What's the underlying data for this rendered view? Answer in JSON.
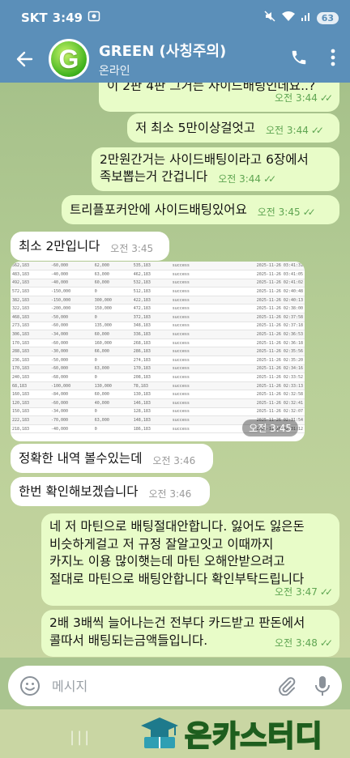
{
  "status": {
    "carrier": "SKT",
    "time": "3:49",
    "battery": "63"
  },
  "header": {
    "avatar_letter": "G",
    "title": "GREEN (사칭주의)",
    "subtitle": "온라인"
  },
  "messages": [
    {
      "text": "이 2판 4판 그거는 사이드배팅인데요..?",
      "time": "오전 3:44"
    },
    {
      "text": "저 최소 5만이상걸엇고",
      "time": "오전 3:44"
    },
    {
      "line1": "2만원간거는 사이드배팅이라고 6장에서",
      "line2": "족보뽑는거 간겁니다",
      "time": "오전 3:44"
    },
    {
      "text": "트리플포커안에 사이드배팅있어요",
      "time": "오전 3:45"
    },
    {
      "text": "최소 2만입니다",
      "time": "오전 3:45"
    },
    {
      "photo_time": "오전 3:45"
    },
    {
      "text": "정확한 내역 볼수있는데",
      "time": "오전 3:46"
    },
    {
      "text": "한번 확인해보겠습니다",
      "time": "오전 3:46"
    },
    {
      "lines": [
        "네 저 마틴으로 배팅절대안합니다. 잃어도 잃은돈",
        "비슷하게걸고 저 규정 잘알고잇고 이때까지",
        "카지노 이용 많이햇는데 마틴 오해안받으려고",
        "절대로 마틴으로 배팅안합니다 확인부탁드립니다"
      ],
      "time": "오전 3:47"
    },
    {
      "lines": [
        "2배 3배씩 늘어나는건 전부다 카드받고 판돈에서",
        "콜따서 배팅되는금액들입니다."
      ],
      "time": "오전 3:48"
    }
  ],
  "photo_table": [
    [
      "562,183",
      "-60,000",
      "62,000",
      "535,183",
      "success",
      "2025-11-26 03:41:31"
    ],
    [
      "483,183",
      "-40,000",
      "63,000",
      "462,183",
      "success",
      "2025-11-26 03:41:05"
    ],
    [
      "492,183",
      "-40,000",
      "60,000",
      "532,183",
      "success",
      "2025-11-26 02:41:02"
    ],
    [
      "572,183",
      "-150,000",
      "0",
      "512,183",
      "success",
      "2025-11-26 02:40:48"
    ],
    [
      "382,183",
      "-150,000",
      "300,000",
      "422,183",
      "success",
      "2025-11-26 02:40:13"
    ],
    [
      "322,183",
      "-200,000",
      "150,000",
      "472,183",
      "success",
      "2025-11-26 02:38:00"
    ],
    [
      "468,183",
      "-50,000",
      "0",
      "372,183",
      "success",
      "2025-11-26 02:37:58"
    ],
    [
      "273,183",
      "-60,000",
      "135,000",
      "348,183",
      "success",
      "2025-11-26 02:37:18"
    ],
    [
      "306,183",
      "-34,000",
      "60,000",
      "336,183",
      "success",
      "2025-11-26 02:36:53"
    ],
    [
      "170,183",
      "-60,000",
      "160,000",
      "268,183",
      "success",
      "2025-11-26 02:36:18"
    ],
    [
      "288,183",
      "-30,000",
      "66,000",
      "286,183",
      "success",
      "2025-11-26 02:35:56"
    ],
    [
      "236,183",
      "-50,000",
      "0",
      "274,183",
      "success",
      "2025-11-26 02:35:20"
    ],
    [
      "170,183",
      "-60,000",
      "63,000",
      "170,183",
      "success",
      "2025-11-26 02:34:16"
    ],
    [
      "240,183",
      "-68,000",
      "0",
      "208,183",
      "success",
      "2025-11-26 02:33:52"
    ],
    [
      "68,183",
      "-100,000",
      "130,000",
      "78,183",
      "success",
      "2025-11-26 02:33:13"
    ],
    [
      "160,183",
      "-84,000",
      "60,000",
      "130,183",
      "success",
      "2025-11-26 02:32:58"
    ],
    [
      "120,183",
      "-60,000",
      "40,000",
      "146,183",
      "success",
      "2025-11-26 02:32:41"
    ],
    [
      "150,183",
      "-34,000",
      "0",
      "128,183",
      "success",
      "2025-11-26 02:32:07"
    ],
    [
      "222,183",
      "-70,000",
      "63,000",
      "148,183",
      "success",
      "2025-11-26 02:31:54"
    ],
    [
      "218,183",
      "-40,000",
      "0",
      "186,183",
      "success",
      "2025-11-26 02:31:12"
    ]
  ],
  "composer": {
    "placeholder": "메시지"
  },
  "watermark": {
    "text": "온카스터디"
  },
  "colors": {
    "header": "#5b8fb9",
    "outgoing_bubble": "#e8fcc8",
    "incoming_bubble": "#ffffff",
    "read_check": "#5fa552"
  }
}
